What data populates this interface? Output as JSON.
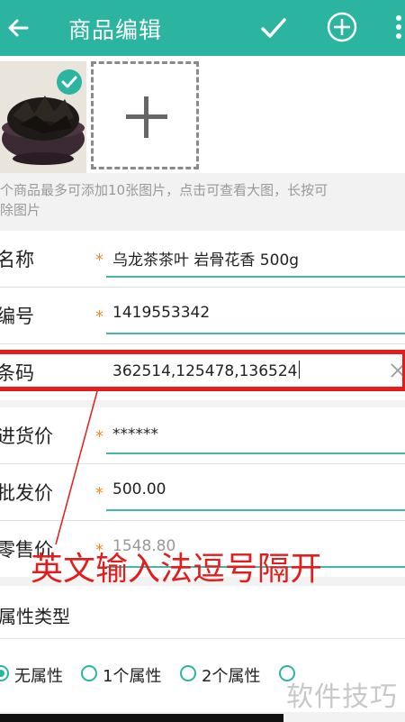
{
  "header": {
    "title": "商品编辑",
    "color": "#2bb5a0"
  },
  "photos": {
    "hint_line1": "个商品最多可添加10张图片，点击可查看大图，长按可",
    "hint_line2": "除图片"
  },
  "form": {
    "name_label": "名称",
    "name_value": "乌龙茶茶叶 岩骨花香 500g",
    "code_label": "编号",
    "code_value": "1419553342",
    "barcode_label": "条码",
    "barcode_value": "362514,125478,136524",
    "cost_label": "进货价",
    "cost_value": "******",
    "wholesale_label": "批发价",
    "wholesale_value": "500.00",
    "retail_label": "零售价",
    "retail_value": "1548.80",
    "required_mark": "*"
  },
  "annotation": {
    "text": "英文输入法逗号隔开",
    "color": "#e31c1c"
  },
  "attributes": {
    "title": "属性类型",
    "options": [
      "无属性",
      "1个属性",
      "2个属性"
    ],
    "selected": "无属性"
  },
  "watermark": "软件技巧"
}
